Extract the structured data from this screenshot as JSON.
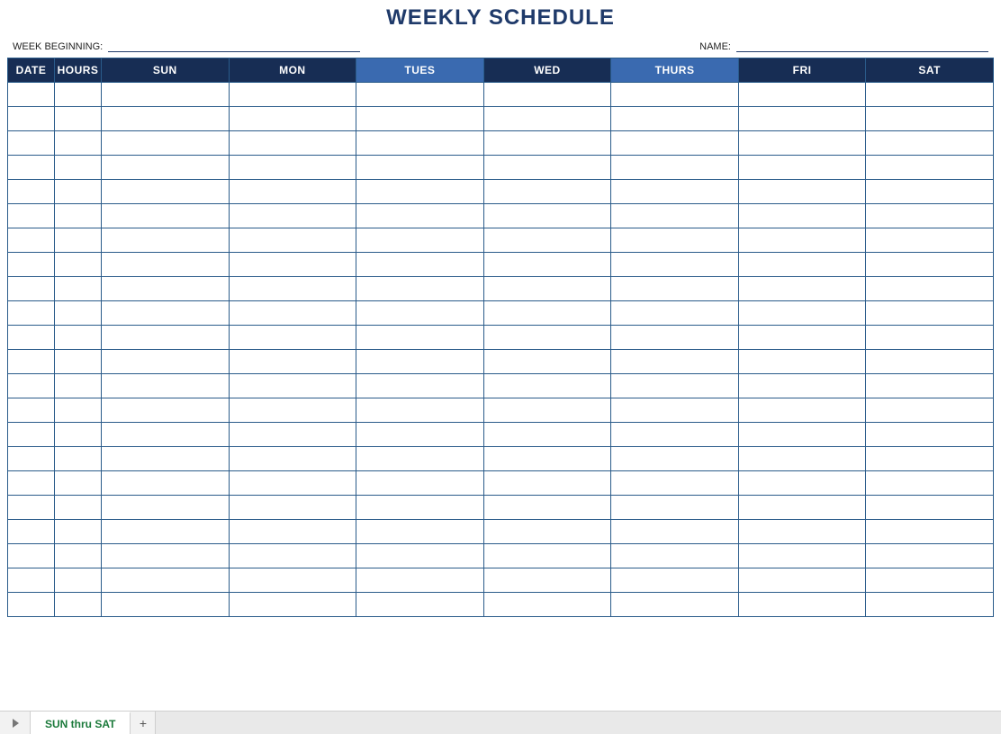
{
  "title": "WEEKLY SCHEDULE",
  "meta": {
    "week_beginning_label": "WEEK BEGINNING:",
    "week_beginning_value": "",
    "name_label": "NAME:",
    "name_value": ""
  },
  "columns": {
    "date": "DATE",
    "hours": "HOURS",
    "sun": "SUN",
    "mon": "MON",
    "tues": "TUES",
    "wed": "WED",
    "thurs": "THURS",
    "fri": "FRI",
    "sat": "SAT"
  },
  "row_count": 22,
  "tabs": {
    "active": "SUN thru SAT"
  }
}
